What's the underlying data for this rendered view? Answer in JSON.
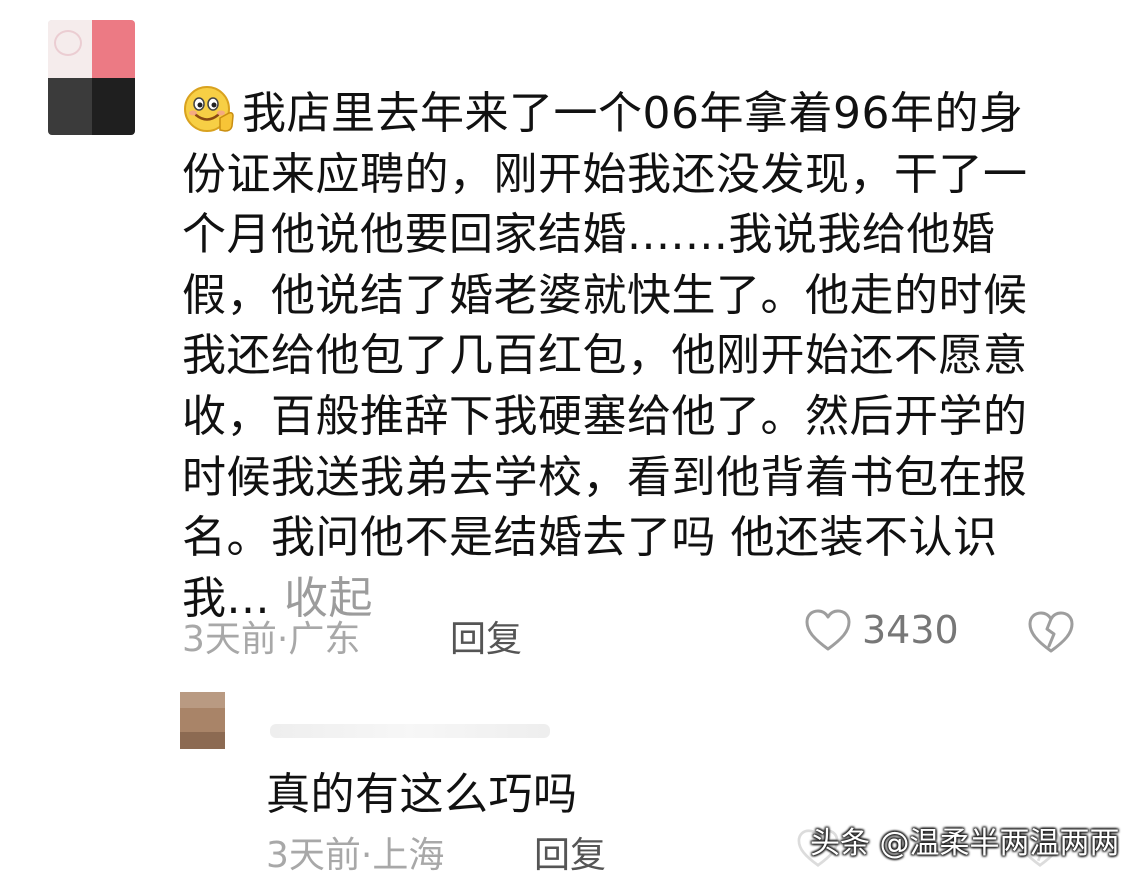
{
  "comment": {
    "lines": [
      "我店里去年来了一个06年拿着96年的身",
      "份证来应聘的，刚开始我还没发现，干了一",
      "个月他说他要回家结婚.......我说我给他婚",
      "假，他说结了婚老婆就快生了。他走的时候",
      "我还给他包了几百红包，他刚开始还不愿意",
      "收，百般推辞下我硬塞给他了。然后开学的",
      "时候我送我弟去学校，看到他背着书包在报",
      "名。我问他不是结婚去了吗 他还装不认识",
      "我..."
    ],
    "collapse_label": "收起",
    "time_location": "3天前·广东",
    "reply_label": "回复",
    "like_count": "3430",
    "emoji_icon": "smile-emoji-icon",
    "colors": {
      "text": "#111111",
      "meta": "#a8a8a8",
      "reply": "#555555",
      "collapse": "#9c9c9c"
    }
  },
  "reply": {
    "text": "真的有这么巧吗",
    "time_location": "3天前·上海",
    "reply_label": "回复"
  },
  "watermark": "头条 @温柔半两温两两"
}
